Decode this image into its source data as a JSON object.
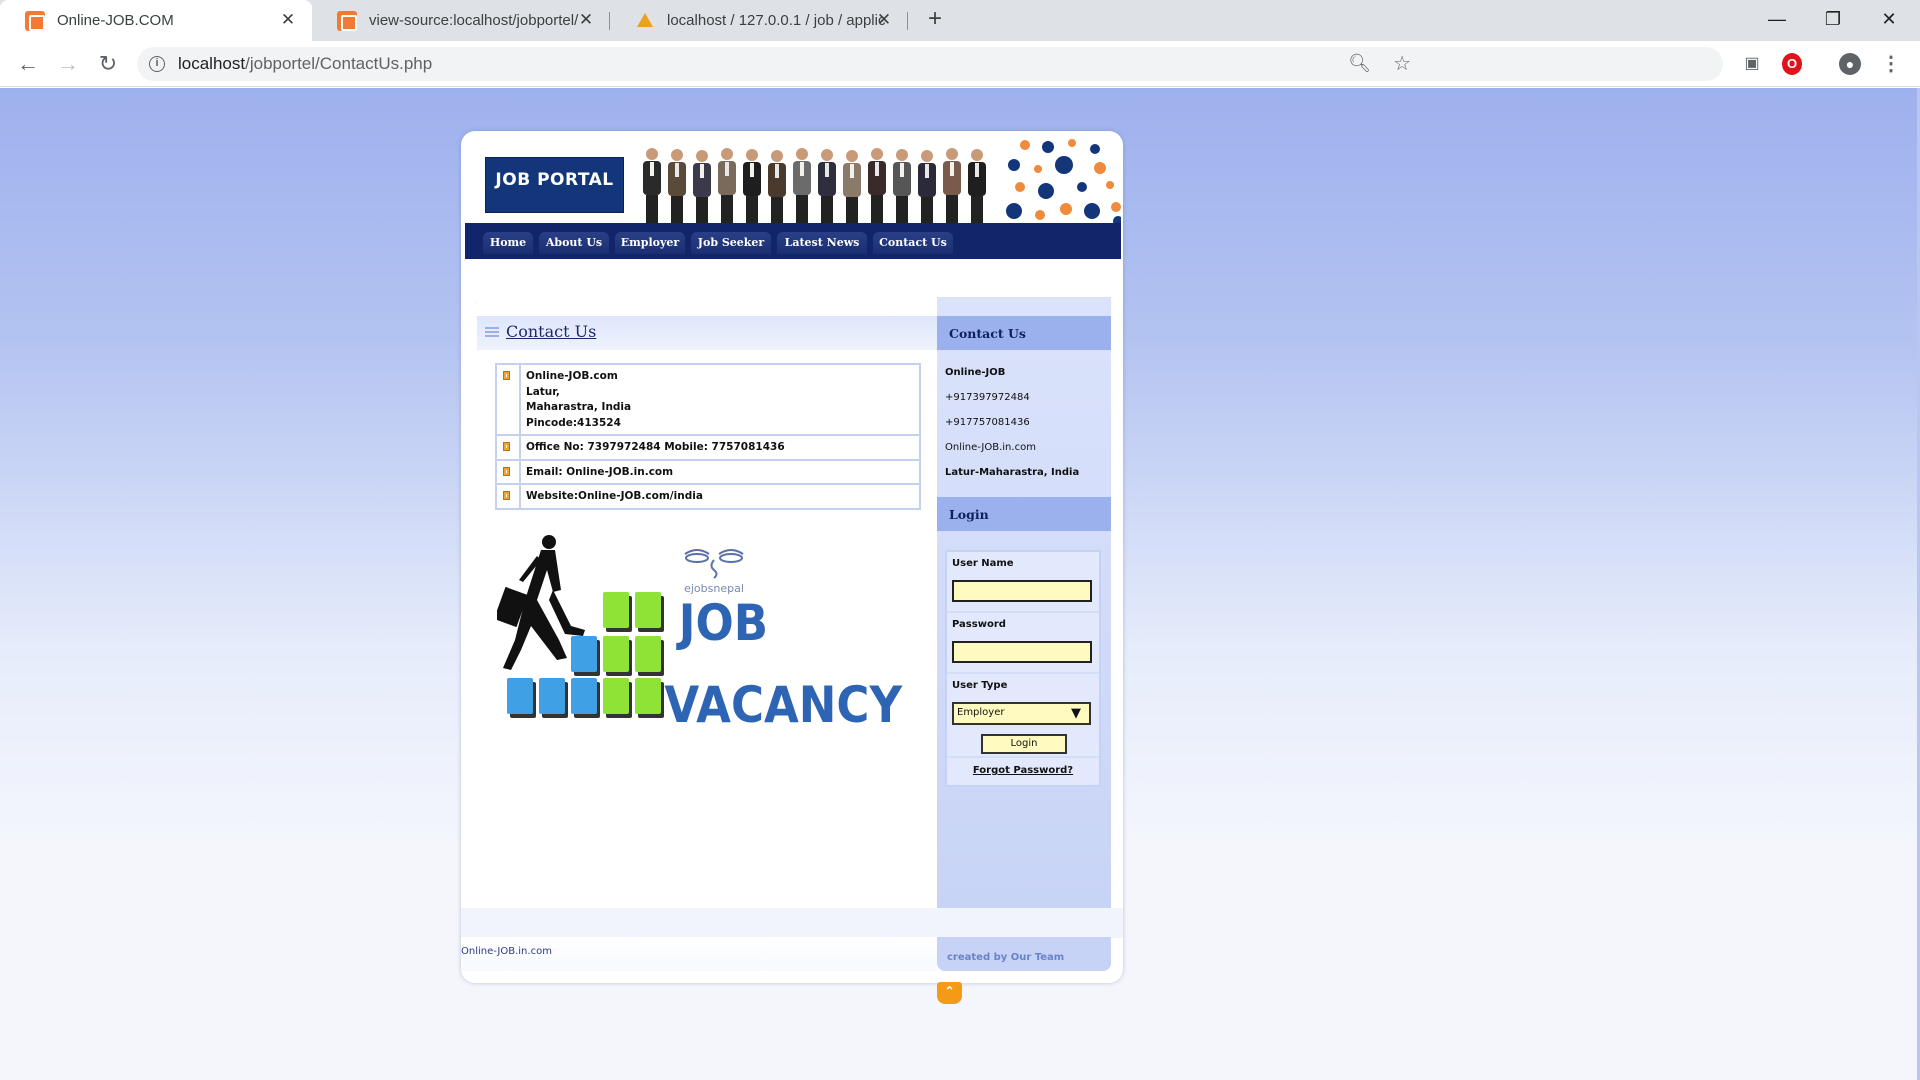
{
  "browser": {
    "tabs": [
      {
        "title": "Online-JOB.COM",
        "active": true
      },
      {
        "title": "view-source:localhost/jobportel/",
        "active": false
      },
      {
        "title": "localhost / 127.0.0.1 / job / applic",
        "active": false
      }
    ],
    "close_glyph": "✕",
    "new_tab_glyph": "+",
    "url_host": "localhost",
    "url_path": "/jobportel/ContactUs.php",
    "window_controls": [
      "—",
      "❐",
      "✕"
    ]
  },
  "site": {
    "logo": "JOB PORTAL",
    "nav": [
      "Home",
      "About Us",
      "Employer",
      "Job Seeker",
      "Latest News",
      "Contact Us"
    ],
    "main_heading": "Contact Us",
    "address_lines": [
      "Online-JOB.com",
      "Latur,",
      "Maharastra, India",
      "Pincode:413524"
    ],
    "office": "Office No: 7397972484 Mobile: 7757081436",
    "email": "Email: Online-JOB.in.com",
    "website": "Website:Online-JOB.com/india",
    "vacancy_image": {
      "brand": "ejobsnepal",
      "line1": "JOB",
      "line2": "VACANCY"
    }
  },
  "sidebar": {
    "contact_heading": "Contact Us",
    "contact_lines": [
      "Online-JOB",
      "+917397972484",
      "+917757081436",
      "Online-JOB.in.com",
      "Latur-Maharastra, India"
    ],
    "login_heading": "Login",
    "username_label": "User Name",
    "password_label": "Password",
    "usertype_label": "User Type",
    "usertype_value": "Employer",
    "login_button": "Login",
    "forgot_link": "Forgot Password?"
  },
  "footer": {
    "left": "Online-JOB.in.com",
    "right": "created by Our Team"
  },
  "colors": {
    "nav_bg": "#12246a",
    "logo_bg": "#13357a",
    "sidebar_head": "#9bb1ee",
    "input_bg": "#fffbc0",
    "totop": "#f49a17"
  }
}
